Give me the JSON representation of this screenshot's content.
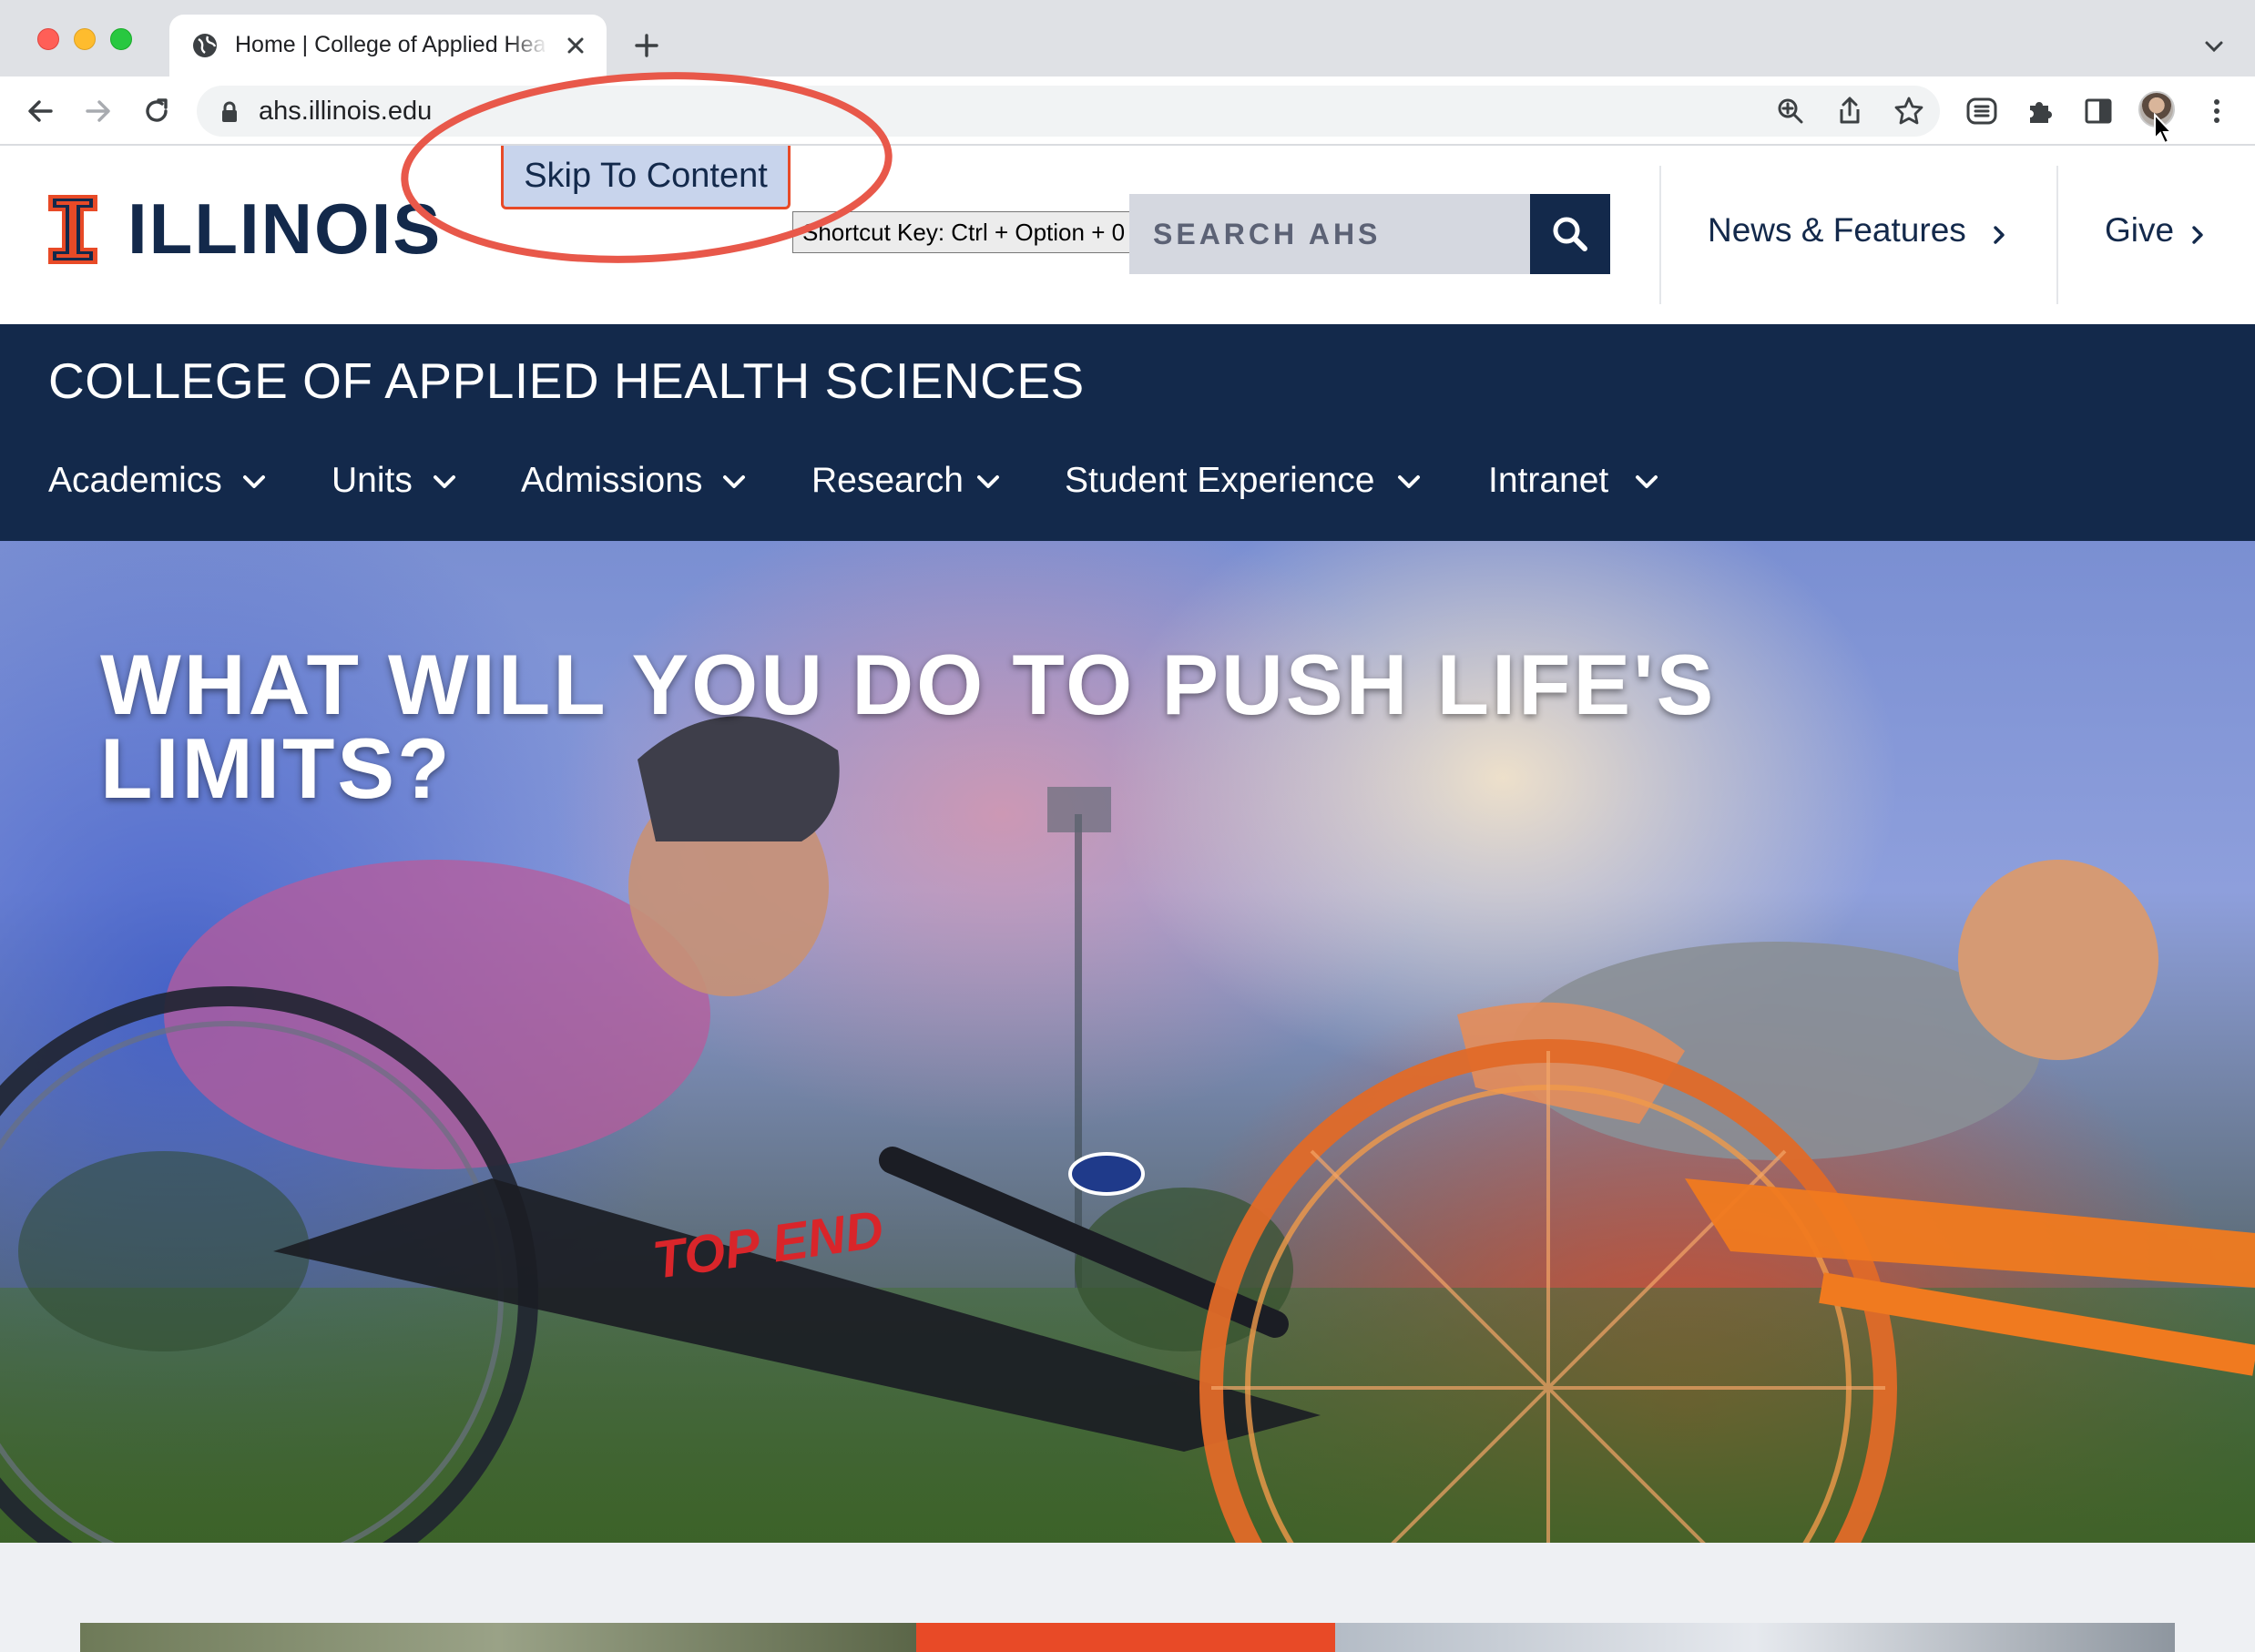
{
  "browser": {
    "tab_title": "Home | College of Applied Hea",
    "url": "ahs.illinois.edu"
  },
  "header": {
    "logo_text": "ILLINOIS",
    "skip_link": "Skip To Content",
    "shortcut_tip": "Shortcut Key: Ctrl + Option + 0",
    "search_placeholder": "SEARCH AHS",
    "links": [
      {
        "label": "News & Features"
      },
      {
        "label": "Give"
      }
    ]
  },
  "band": {
    "title": "COLLEGE OF APPLIED HEALTH SCIENCES",
    "nav": [
      {
        "label": "Academics"
      },
      {
        "label": "Units"
      },
      {
        "label": "Admissions"
      },
      {
        "label": "Research"
      },
      {
        "label": "Student Experience"
      },
      {
        "label": "Intranet"
      }
    ]
  },
  "hero": {
    "headline": "WHAT WILL YOU DO TO PUSH LIFE'S LIMITS?",
    "bike_brand": "TOP END"
  },
  "colors": {
    "illinois_blue": "#13294b",
    "illinois_orange": "#e84a27",
    "annotation_red": "#e8584a"
  }
}
